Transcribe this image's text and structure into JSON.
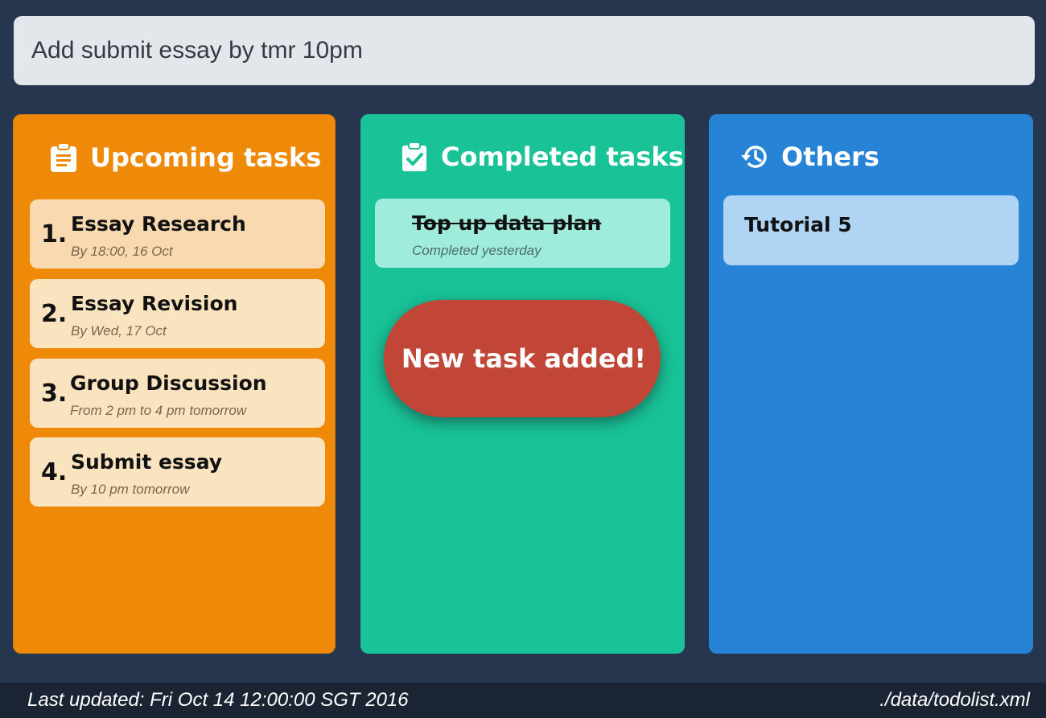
{
  "command": {
    "value": "Add submit essay by tmr 10pm"
  },
  "panels": {
    "upcoming": {
      "title": "Upcoming tasks",
      "icon": "clipboard-icon",
      "color": "#ef8a08",
      "tasks": [
        {
          "num": "1.",
          "title": "Essay Research",
          "sub": "By 18:00, 16 Oct"
        },
        {
          "num": "2.",
          "title": "Essay Revision",
          "sub": "By Wed, 17 Oct"
        },
        {
          "num": "3.",
          "title": "Group Discussion",
          "sub": "From 2 pm to 4 pm tomorrow"
        },
        {
          "num": "4.",
          "title": "Submit essay",
          "sub": "By 10 pm tomorrow"
        }
      ]
    },
    "completed": {
      "title": "Completed tasks",
      "icon": "clipboard-check-icon",
      "color": "#19c397",
      "tasks": [
        {
          "title": "Top up data plan",
          "sub": "Completed yesterday"
        }
      ]
    },
    "others": {
      "title": "Others",
      "icon": "history-icon",
      "color": "#2683d6",
      "tasks": [
        {
          "title": "Tutorial 5"
        }
      ]
    }
  },
  "toast": {
    "message": "New task added!",
    "color": "#c14637"
  },
  "status": {
    "last_updated": "Last updated: Fri Oct 14 12:00:00 SGT 2016",
    "file_path": "./data/todolist.xml"
  }
}
